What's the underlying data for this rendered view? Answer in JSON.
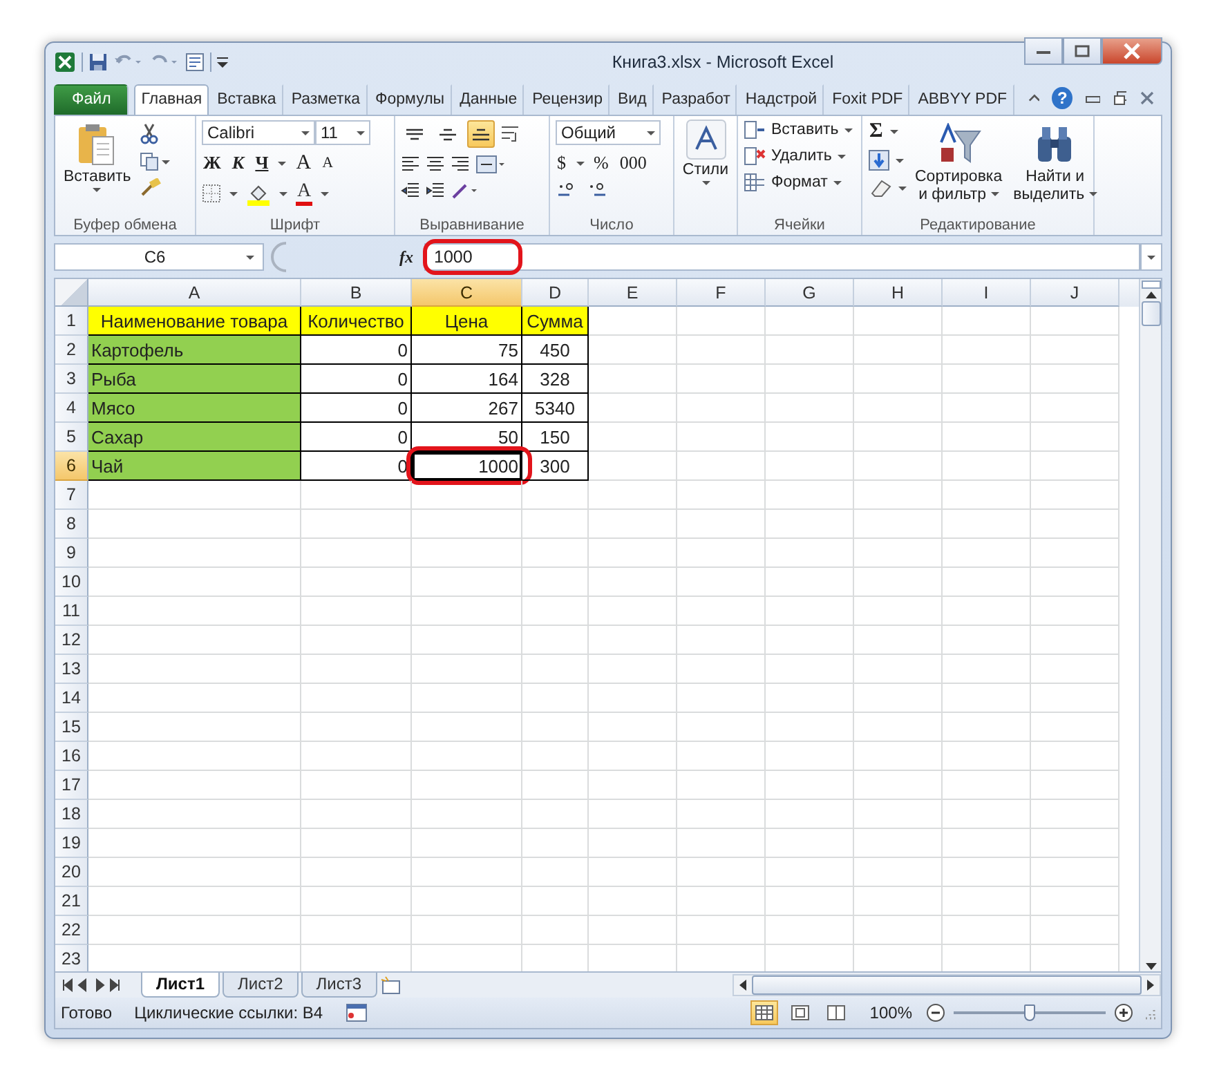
{
  "window": {
    "title": "Книга3.xlsx - Microsoft Excel",
    "help_label": "?"
  },
  "tabs": [
    {
      "label": "Файл",
      "kind": "file",
      "selected": false
    },
    {
      "label": "Главная",
      "kind": "tab",
      "selected": true
    },
    {
      "label": "Вставка",
      "kind": "tab",
      "selected": false
    },
    {
      "label": "Разметка",
      "kind": "tab",
      "selected": false
    },
    {
      "label": "Формулы",
      "kind": "tab",
      "selected": false
    },
    {
      "label": "Данные",
      "kind": "tab",
      "selected": false
    },
    {
      "label": "Рецензир",
      "kind": "tab",
      "selected": false
    },
    {
      "label": "Вид",
      "kind": "tab",
      "selected": false
    },
    {
      "label": "Разработ",
      "kind": "tab",
      "selected": false
    },
    {
      "label": "Надстрой",
      "kind": "tab",
      "selected": false
    },
    {
      "label": "Foxit PDF",
      "kind": "tab",
      "selected": false
    },
    {
      "label": "ABBYY PDF",
      "kind": "tab",
      "selected": false
    }
  ],
  "ribbon": {
    "clipboard": {
      "label": "Буфер обмена",
      "paste": "Вставить"
    },
    "font": {
      "label": "Шрифт",
      "font_name": "Calibri",
      "font_size": "11",
      "bold": "Ж",
      "italic": "К",
      "underline": "Ч",
      "grow": "A",
      "shrink": "A",
      "font_color": "A"
    },
    "alignment": {
      "label": "Выравнивание",
      "valign": [
        {
          "selected": false
        },
        {
          "selected": false
        },
        {
          "selected": true
        }
      ]
    },
    "number": {
      "label": "Число",
      "format": "Общий",
      "currency": "$",
      "percent": "%",
      "thousands": "000"
    },
    "styles": {
      "label": "Стили"
    },
    "cells": {
      "label": "Ячейки",
      "items": [
        "Вставить",
        "Удалить",
        "Формат"
      ]
    },
    "editing": {
      "label": "Редактирование",
      "sum": "Σ",
      "sort": [
        "Сортировка",
        "и фильтр"
      ],
      "find": [
        "Найти и",
        "выделить"
      ]
    }
  },
  "formula_bar": {
    "name_box": "C6",
    "function_label": "fx",
    "value": "1000",
    "annotated": true
  },
  "grid": {
    "columns": [
      {
        "label": "A",
        "selected": false
      },
      {
        "label": "B",
        "selected": false
      },
      {
        "label": "C",
        "selected": true
      },
      {
        "label": "D",
        "selected": false
      },
      {
        "label": "E",
        "selected": false
      },
      {
        "label": "F",
        "selected": false
      },
      {
        "label": "G",
        "selected": false
      },
      {
        "label": "H",
        "selected": false
      },
      {
        "label": "I",
        "selected": false
      },
      {
        "label": "J",
        "selected": false
      }
    ],
    "rows": [
      {
        "header": "1",
        "selected": false,
        "cells": [
          {
            "text": "Наименование товара",
            "kind": "header",
            "color": "#ffff00",
            "selected": false,
            "annotated": false
          },
          {
            "text": "Количество",
            "kind": "header",
            "color": "#ffff00",
            "selected": false,
            "annotated": false
          },
          {
            "text": "Цена",
            "kind": "header",
            "color": "#ffff00",
            "selected": false,
            "annotated": false
          },
          {
            "text": "Сумма",
            "kind": "header",
            "color": "#ffff00",
            "selected": false,
            "annotated": false
          }
        ]
      },
      {
        "header": "2",
        "selected": false,
        "cells": [
          {
            "text": "Картофель",
            "kind": "label",
            "color": "#92d050",
            "selected": false,
            "annotated": false
          },
          {
            "text": "0",
            "kind": "number",
            "selected": false,
            "annotated": false
          },
          {
            "text": "75",
            "kind": "number",
            "selected": false,
            "annotated": false
          },
          {
            "text": "450",
            "kind": "total",
            "selected": false,
            "annotated": false
          }
        ]
      },
      {
        "header": "3",
        "selected": false,
        "cells": [
          {
            "text": "Рыба",
            "kind": "label",
            "color": "#92d050",
            "selected": false,
            "annotated": false
          },
          {
            "text": "0",
            "kind": "number",
            "selected": false,
            "annotated": false
          },
          {
            "text": "164",
            "kind": "number",
            "selected": false,
            "annotated": false
          },
          {
            "text": "328",
            "kind": "total",
            "selected": false,
            "annotated": false
          }
        ]
      },
      {
        "header": "4",
        "selected": false,
        "cells": [
          {
            "text": "Мясо",
            "kind": "label",
            "color": "#92d050",
            "selected": false,
            "annotated": false
          },
          {
            "text": "0",
            "kind": "number",
            "selected": false,
            "annotated": false
          },
          {
            "text": "267",
            "kind": "number",
            "selected": false,
            "annotated": false
          },
          {
            "text": "5340",
            "kind": "total",
            "selected": false,
            "annotated": false
          }
        ]
      },
      {
        "header": "5",
        "selected": false,
        "cells": [
          {
            "text": "Сахар",
            "kind": "label",
            "color": "#92d050",
            "selected": false,
            "annotated": false
          },
          {
            "text": "0",
            "kind": "number",
            "selected": false,
            "annotated": false
          },
          {
            "text": "50",
            "kind": "number",
            "selected": false,
            "annotated": false
          },
          {
            "text": "150",
            "kind": "total",
            "selected": false,
            "annotated": false
          }
        ]
      },
      {
        "header": "6",
        "selected": true,
        "cells": [
          {
            "text": "Чай",
            "kind": "label",
            "color": "#92d050",
            "selected": false,
            "annotated": false
          },
          {
            "text": "0",
            "kind": "number",
            "selected": false,
            "annotated": false
          },
          {
            "text": "1000",
            "kind": "number",
            "selected": true,
            "annotated": true
          },
          {
            "text": "300",
            "kind": "total",
            "selected": false,
            "annotated": false
          }
        ]
      },
      {
        "header": "7",
        "selected": false
      },
      {
        "header": "8",
        "selected": false
      },
      {
        "header": "9",
        "selected": false
      },
      {
        "header": "10",
        "selected": false
      },
      {
        "header": "11",
        "selected": false
      },
      {
        "header": "12",
        "selected": false
      },
      {
        "header": "13",
        "selected": false
      },
      {
        "header": "14",
        "selected": false
      },
      {
        "header": "15",
        "selected": false
      },
      {
        "header": "16",
        "selected": false
      },
      {
        "header": "17",
        "selected": false
      },
      {
        "header": "18",
        "selected": false
      },
      {
        "header": "19",
        "selected": false
      },
      {
        "header": "20",
        "selected": false
      },
      {
        "header": "21",
        "selected": false
      },
      {
        "header": "22",
        "selected": false
      },
      {
        "header": "23",
        "selected": false
      }
    ]
  },
  "sheets": [
    {
      "label": "Лист1",
      "selected": true
    },
    {
      "label": "Лист2",
      "selected": false
    },
    {
      "label": "Лист3",
      "selected": false
    }
  ],
  "status_bar": {
    "ready": "Готово",
    "circular": "Циклические ссылки: B4",
    "zoom": "100%",
    "zoom_slider": {
      "level": 0.5
    }
  }
}
